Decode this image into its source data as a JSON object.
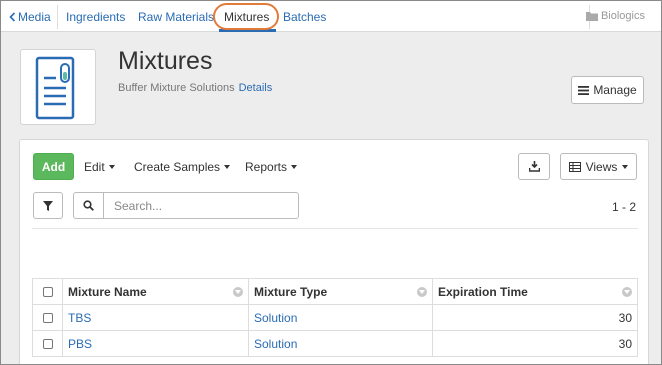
{
  "nav": {
    "back_label": "Media",
    "tabs": [
      {
        "label": "Ingredients"
      },
      {
        "label": "Raw Materials"
      },
      {
        "label": "Mixtures",
        "active": true
      },
      {
        "label": "Batches"
      }
    ],
    "project_label": "Biologics"
  },
  "header": {
    "title": "Mixtures",
    "subtitle": "Buffer Mixture Solutions",
    "details_link": "Details",
    "manage_button": "Manage",
    "icon": "document-flask-icon"
  },
  "toolbar": {
    "add_label": "Add",
    "edit_label": "Edit",
    "create_samples_label": "Create Samples",
    "reports_label": "Reports",
    "views_label": "Views",
    "export_icon": "download-icon"
  },
  "search": {
    "placeholder": "Search...",
    "value": ""
  },
  "pagination": {
    "text": "1 - 2"
  },
  "table": {
    "columns": [
      "Mixture Name",
      "Mixture Type",
      "Expiration Time"
    ],
    "rows": [
      {
        "name": "TBS",
        "type": "Solution",
        "expiration": "30"
      },
      {
        "name": "PBS",
        "type": "Solution",
        "expiration": "30"
      }
    ]
  },
  "colors": {
    "link": "#2a6cb4",
    "add_button": "#5cb85c",
    "highlight_oval": "#e07b39"
  }
}
